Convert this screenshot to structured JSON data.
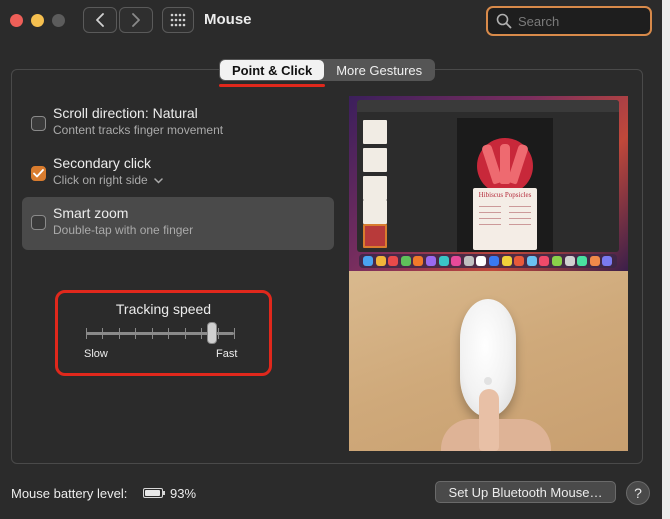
{
  "window": {
    "title": "Mouse"
  },
  "search": {
    "placeholder": "Search"
  },
  "tabs": [
    {
      "label": "Point & Click",
      "active": true
    },
    {
      "label": "More Gestures",
      "active": false
    }
  ],
  "options": [
    {
      "title": "Scroll direction: Natural",
      "subtitle": "Content tracks finger movement",
      "checked": false
    },
    {
      "title": "Secondary click",
      "subtitle": "Click on right side",
      "checked": true,
      "has_dropdown": true
    },
    {
      "title": "Smart zoom",
      "subtitle": "Double-tap with one finger",
      "checked": false,
      "highlighted": true
    }
  ],
  "tracking": {
    "label": "Tracking speed",
    "min_label": "Slow",
    "max_label": "Fast",
    "ticks": 10,
    "value_fraction": 0.85
  },
  "preview": {
    "recipe_title": "Hibiscus Popsicles"
  },
  "footer": {
    "battery_label": "Mouse battery level:",
    "battery_percent": "93%",
    "bluetooth_button": "Set Up Bluetooth Mouse…",
    "help_button": "?"
  },
  "colors": {
    "accent": "#d97c2e",
    "annotation": "#e0281c",
    "search_focus": "#d88a4a"
  }
}
